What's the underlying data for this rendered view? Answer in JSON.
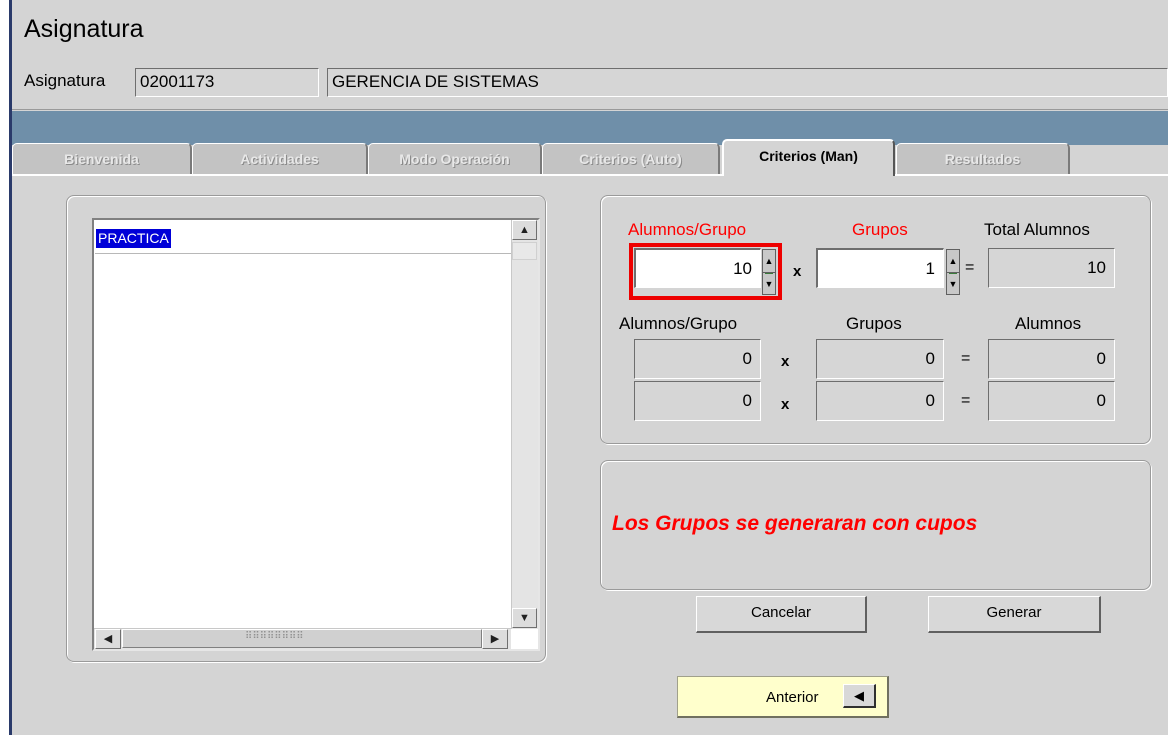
{
  "header": {
    "title": "Asignatura",
    "field_label": "Asignatura",
    "code": "02001173",
    "name": "GERENCIA DE SISTEMAS"
  },
  "tabs": [
    {
      "label": "Bienvenida",
      "active": false
    },
    {
      "label": "Actividades",
      "active": false
    },
    {
      "label": "Modo Operación",
      "active": false
    },
    {
      "label": "Criterios (Auto)",
      "active": false
    },
    {
      "label": "Criterios (Man)",
      "active": true
    },
    {
      "label": "Resultados",
      "active": false
    }
  ],
  "list": {
    "items": [
      "PRACTICA"
    ],
    "selected": "PRACTICA"
  },
  "calc": {
    "header1": {
      "alumnos_grupo": "Alumnos/Grupo",
      "grupos": "Grupos",
      "total": "Total Alumnos"
    },
    "row1": {
      "alumnos_grupo": "10",
      "grupos": "1",
      "total": "10"
    },
    "header2": {
      "alumnos_grupo": "Alumnos/Grupo",
      "grupos": "Grupos",
      "alumnos": "Alumnos"
    },
    "row2": {
      "alumnos_grupo": "0",
      "grupos": "0",
      "alumnos": "0"
    },
    "row3": {
      "alumnos_grupo": "0",
      "grupos": "0",
      "alumnos": "0"
    },
    "times": "x",
    "equals": "="
  },
  "message": "Los Grupos se generaran con cupos",
  "buttons": {
    "cancel": "Cancelar",
    "generate": "Generar",
    "previous": "Anterior"
  },
  "icons": {
    "previous": "arrow-left-icon",
    "spinner": "spinner-arrows-icon"
  },
  "colors": {
    "accent_red": "#ff0000",
    "band_blue": "#6f8fa9",
    "selection_blue": "#0000d8",
    "button_yellow": "#ffffcc"
  }
}
